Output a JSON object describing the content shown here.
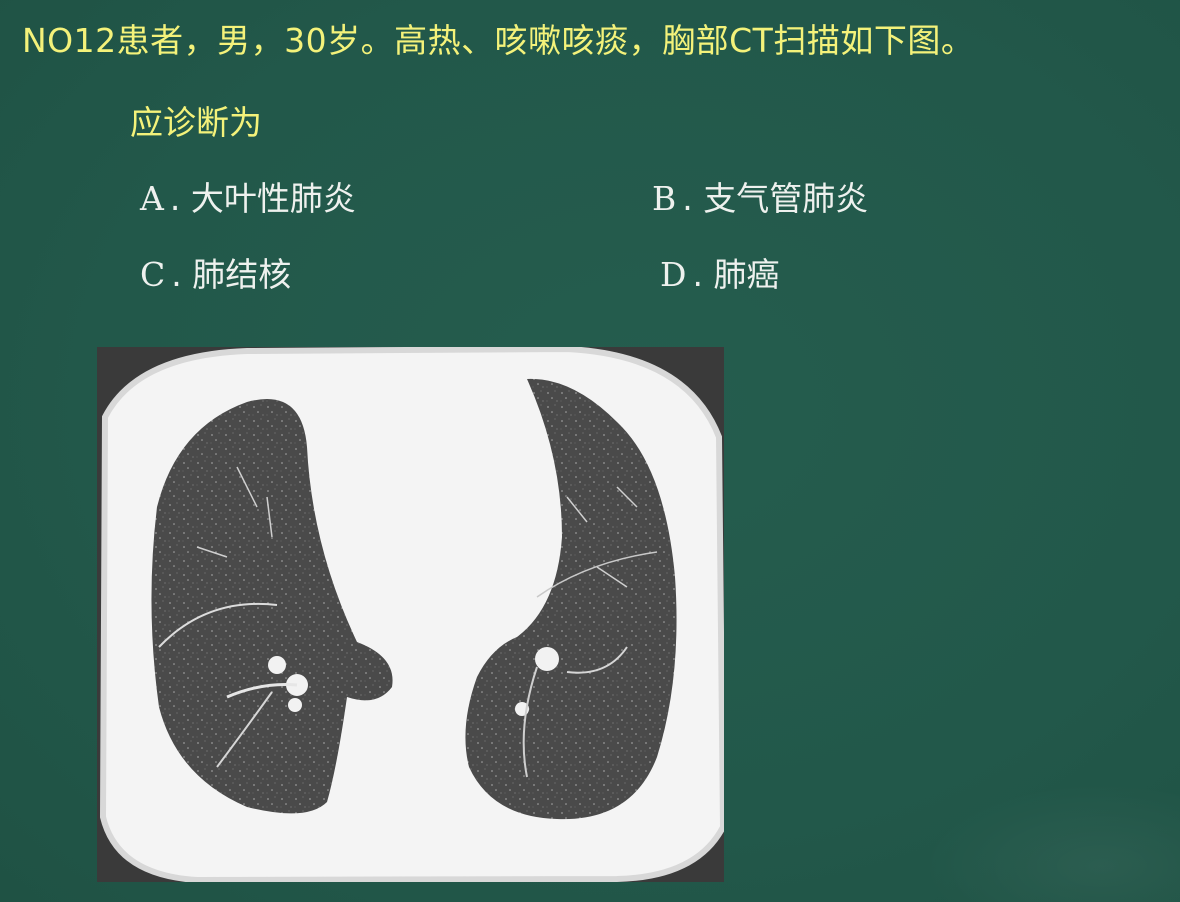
{
  "question": {
    "line1": "NO12患者，男，30岁。高热、咳嗽咳痰，胸部CT扫描如下图。",
    "line2": "应诊断为"
  },
  "options": [
    {
      "letter": "A",
      "sep": ".",
      "text": "大叶性肺炎"
    },
    {
      "letter": "B",
      "sep": ".",
      "text": "支气管肺炎"
    },
    {
      "letter": "C",
      "sep": ".",
      "text": "肺结核"
    },
    {
      "letter": "D",
      "sep": ".",
      "text": "肺癌"
    }
  ],
  "colors": {
    "background": "#22584a",
    "question_text": "#f4f27a",
    "option_text": "#eef1ee"
  }
}
